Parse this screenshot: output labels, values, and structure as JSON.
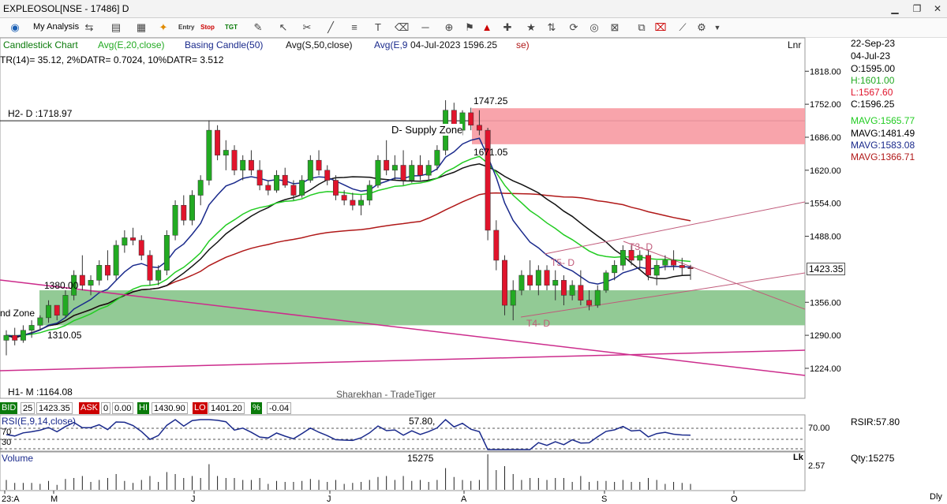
{
  "window": {
    "title": "EXPLEOSOL[NSE - 17486] D",
    "minimize": "▁",
    "restore": "❐",
    "close": "✕"
  },
  "toolbar": {
    "my_analysis": "My Analysis",
    "entry": "Entry",
    "stop": "Stop",
    "tgt": "TGT"
  },
  "legend": {
    "candlestick": "Candlestick Chart",
    "ema20": "Avg(E,20,close)",
    "basing": "Basing Candle(50)",
    "sma50": "Avg(S,50,close)",
    "ema_other": "Avg(E,9",
    "cursor": "04-Jul-2023 1596.25",
    "tail": "se)",
    "scale": "Lnr"
  },
  "atr_text": "TR(14)= 35.12, 2%DATR= 0.7024, 10%DATR= 3.512",
  "side": {
    "date1": "22-Sep-23",
    "date2": "04-Jul-23",
    "open": "O:1595.00",
    "high": "H:1601.00",
    "low": "L:1567.60",
    "close": "C:1596.25",
    "mavg1": "MAVG:1565.77",
    "mavg2": "MAVG:1481.49",
    "mavg3": "MAVG:1583.08",
    "mavg4": "MAVG:1366.71",
    "rsir": "RSIR:57.80",
    "qty": "Qty:15275",
    "dly": "Dly",
    "lk": "Lk"
  },
  "colors": {
    "up": "#22aa22",
    "down": "#e0142c",
    "ema9": "#1a2a8c",
    "ema20": "#22cc22",
    "sma50": "#111111",
    "ma200": "#b01818",
    "supply": "#f79aa2",
    "demand": "#86c48a",
    "trend": "#cc2c8c",
    "channel": "#c05a7a"
  },
  "annotations": {
    "h2": "H2- D :1718.97",
    "h1": "H1- M :1164.08",
    "supply": "D- Supply Zone",
    "demand": "nd Zone",
    "p1747": "1747.25",
    "p1671": "1671.05",
    "p1380": "1380.00",
    "p1310": "1310.05",
    "t5": "T5- D",
    "t3": "T3- D",
    "t4": "T4- D",
    "watermark": "Sharekhan - TradeTiger"
  },
  "quote": {
    "bid_label": "BID",
    "bid_qty": "25",
    "bid": "1423.35",
    "ask_label": "ASK",
    "ask_qty": "0",
    "ask": "0.00",
    "hi_label": "HI",
    "hi": "1430.90",
    "lo_label": "LO",
    "lo": "1401.20",
    "pct_label": "%",
    "pct": "-0.04"
  },
  "rsi": {
    "label": "RSI(E,9,14,close)",
    "value_label": "57.80,",
    "level70": "70",
    "level30": "30",
    "axis70": "70.00"
  },
  "volume": {
    "label": "Volume",
    "value_label": "15275",
    "axis": "2.57"
  },
  "chart_data": {
    "type": "candlestick",
    "y_ticks": [
      "1818.00",
      "1752.00",
      "1686.00",
      "1620.00",
      "1554.00",
      "1488.00",
      "1356.00",
      "1290.00",
      "1224.00"
    ],
    "ylim": [
      1160,
      1850
    ],
    "last_price": "1423.35",
    "x_ticks": [
      "23:A",
      "M",
      "J",
      "J",
      "A",
      "S",
      "O"
    ],
    "zones": {
      "supply": [
        1672,
        1744
      ],
      "demand": [
        1310,
        1380
      ]
    },
    "candles": [
      [
        1280,
        1300,
        1250,
        1290
      ],
      [
        1290,
        1305,
        1270,
        1280
      ],
      [
        1280,
        1310,
        1275,
        1300
      ],
      [
        1300,
        1320,
        1285,
        1310
      ],
      [
        1310,
        1330,
        1300,
        1325
      ],
      [
        1325,
        1360,
        1315,
        1350
      ],
      [
        1350,
        1345,
        1320,
        1330
      ],
      [
        1330,
        1380,
        1325,
        1370
      ],
      [
        1370,
        1420,
        1360,
        1410
      ],
      [
        1410,
        1450,
        1380,
        1390
      ],
      [
        1390,
        1410,
        1370,
        1400
      ],
      [
        1400,
        1440,
        1390,
        1430
      ],
      [
        1430,
        1460,
        1400,
        1410
      ],
      [
        1410,
        1480,
        1400,
        1470
      ],
      [
        1470,
        1500,
        1455,
        1485
      ],
      [
        1485,
        1505,
        1470,
        1480
      ],
      [
        1480,
        1490,
        1440,
        1450
      ],
      [
        1450,
        1460,
        1390,
        1400
      ],
      [
        1400,
        1430,
        1390,
        1420
      ],
      [
        1420,
        1500,
        1410,
        1490
      ],
      [
        1490,
        1560,
        1480,
        1550
      ],
      [
        1550,
        1570,
        1510,
        1520
      ],
      [
        1520,
        1580,
        1510,
        1570
      ],
      [
        1570,
        1610,
        1550,
        1600
      ],
      [
        1600,
        1720,
        1590,
        1700
      ],
      [
        1700,
        1710,
        1640,
        1650
      ],
      [
        1650,
        1680,
        1620,
        1660
      ],
      [
        1660,
        1670,
        1610,
        1620
      ],
      [
        1620,
        1650,
        1600,
        1640
      ],
      [
        1640,
        1660,
        1610,
        1620
      ],
      [
        1620,
        1640,
        1580,
        1590
      ],
      [
        1590,
        1600,
        1570,
        1580
      ],
      [
        1580,
        1620,
        1575,
        1610
      ],
      [
        1610,
        1625,
        1585,
        1590
      ],
      [
        1590,
        1600,
        1560,
        1570
      ],
      [
        1570,
        1610,
        1565,
        1600
      ],
      [
        1600,
        1650,
        1595,
        1640
      ],
      [
        1640,
        1660,
        1610,
        1620
      ],
      [
        1620,
        1630,
        1590,
        1600
      ],
      [
        1600,
        1610,
        1560,
        1570
      ],
      [
        1570,
        1580,
        1550,
        1560
      ],
      [
        1560,
        1575,
        1540,
        1550
      ],
      [
        1550,
        1570,
        1530,
        1560
      ],
      [
        1560,
        1600,
        1550,
        1590
      ],
      [
        1590,
        1650,
        1585,
        1640
      ],
      [
        1640,
        1680,
        1610,
        1620
      ],
      [
        1620,
        1650,
        1600,
        1630
      ],
      [
        1630,
        1660,
        1590,
        1600
      ],
      [
        1600,
        1640,
        1595,
        1630
      ],
      [
        1630,
        1650,
        1600,
        1610
      ],
      [
        1610,
        1640,
        1600,
        1630
      ],
      [
        1630,
        1670,
        1620,
        1660
      ],
      [
        1660,
        1760,
        1650,
        1740
      ],
      [
        1740,
        1755,
        1690,
        1700
      ],
      [
        1700,
        1740,
        1690,
        1735
      ],
      [
        1735,
        1745,
        1700,
        1710
      ],
      [
        1710,
        1740,
        1690,
        1700
      ],
      [
        1700,
        1705,
        1480,
        1500
      ],
      [
        1500,
        1520,
        1420,
        1440
      ],
      [
        1440,
        1450,
        1330,
        1350
      ],
      [
        1350,
        1400,
        1320,
        1380
      ],
      [
        1380,
        1420,
        1370,
        1410
      ],
      [
        1410,
        1440,
        1380,
        1390
      ],
      [
        1390,
        1430,
        1370,
        1420
      ],
      [
        1420,
        1430,
        1380,
        1390
      ],
      [
        1390,
        1420,
        1360,
        1400
      ],
      [
        1400,
        1410,
        1350,
        1370
      ],
      [
        1370,
        1400,
        1360,
        1390
      ],
      [
        1390,
        1420,
        1350,
        1360
      ],
      [
        1360,
        1380,
        1340,
        1350
      ],
      [
        1350,
        1390,
        1345,
        1380
      ],
      [
        1380,
        1420,
        1375,
        1415
      ],
      [
        1415,
        1440,
        1400,
        1430
      ],
      [
        1430,
        1470,
        1420,
        1460
      ],
      [
        1460,
        1470,
        1430,
        1440
      ],
      [
        1440,
        1460,
        1420,
        1450
      ],
      [
        1450,
        1460,
        1400,
        1410
      ],
      [
        1410,
        1440,
        1390,
        1430
      ],
      [
        1430,
        1450,
        1420,
        1440
      ],
      [
        1440,
        1460,
        1420,
        1430
      ],
      [
        1430,
        1445,
        1410,
        1425
      ],
      [
        1425,
        1431,
        1401,
        1423
      ]
    ]
  }
}
